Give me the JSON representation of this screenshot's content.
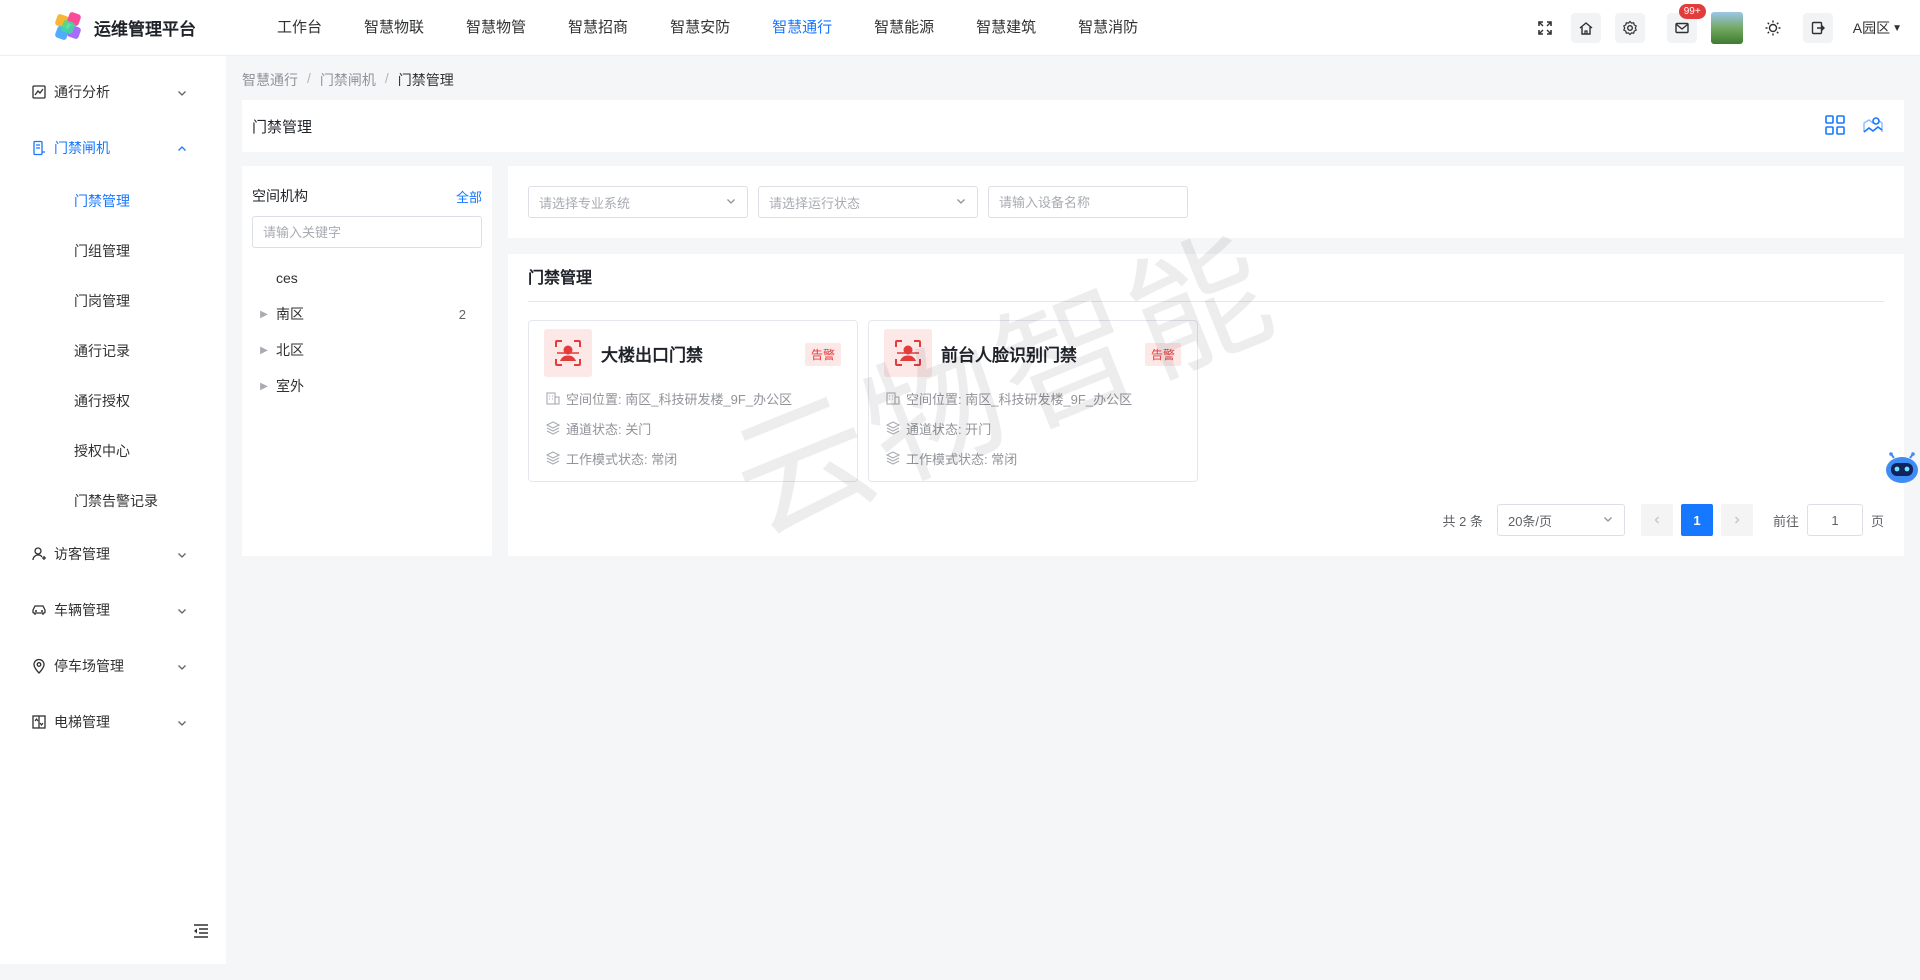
{
  "app": {
    "title": "运维管理平台"
  },
  "nav": {
    "items": [
      "工作台",
      "智慧物联",
      "智慧物管",
      "智慧招商",
      "智慧安防",
      "智慧通行",
      "智慧能源",
      "智慧建筑",
      "智慧消防"
    ],
    "active_index": 5
  },
  "header": {
    "mail_badge": "99+",
    "region": "A园区"
  },
  "sidebar": {
    "items": [
      {
        "label": "通行分析",
        "icon": "chart-icon"
      },
      {
        "label": "门禁闸机",
        "icon": "gate-icon",
        "open": true,
        "children": [
          "门禁管理",
          "门组管理",
          "门岗管理",
          "通行记录",
          "通行授权",
          "授权中心",
          "门禁告警记录"
        ]
      },
      {
        "label": "访客管理",
        "icon": "visitor-icon"
      },
      {
        "label": "车辆管理",
        "icon": "car-icon"
      },
      {
        "label": "停车场管理",
        "icon": "location-icon"
      },
      {
        "label": "电梯管理",
        "icon": "elevator-icon"
      }
    ],
    "active_child": "门禁管理"
  },
  "breadcrumb": [
    "智慧通行",
    "门禁闸机",
    "门禁管理"
  ],
  "page": {
    "title": "门禁管理"
  },
  "tree": {
    "title": "空间机构",
    "all_label": "全部",
    "search_placeholder": "请输入关键字",
    "nodes": [
      {
        "label": "ces",
        "expandable": false,
        "count": ""
      },
      {
        "label": "南区",
        "expandable": true,
        "count": "2"
      },
      {
        "label": "北区",
        "expandable": true,
        "count": ""
      },
      {
        "label": "室外",
        "expandable": true,
        "count": ""
      }
    ]
  },
  "filters": {
    "system_placeholder": "请选择专业系统",
    "status_placeholder": "请选择运行状态",
    "name_placeholder": "请输入设备名称"
  },
  "list": {
    "title": "门禁管理",
    "cards": [
      {
        "name": "大楼出口门禁",
        "badge": "告警",
        "location": "空间位置: 南区_科技研发楼_9F_办公区",
        "channel": "通道状态: 关门",
        "mode": "工作模式状态: 常闭"
      },
      {
        "name": "前台人脸识别门禁",
        "badge": "告警",
        "location": "空间位置: 南区_科技研发楼_9F_办公区",
        "channel": "通道状态: 开门",
        "mode": "工作模式状态: 常闭"
      }
    ]
  },
  "pager": {
    "total": "共 2 条",
    "page_size": "20条/页",
    "current_page": "1",
    "goto_label": "前往",
    "goto_value": "1",
    "page_suffix": "页"
  },
  "watermark": "云物智能",
  "colors": {
    "accent": "#1677ff",
    "alarm": "#e23c3c",
    "alarm_bg": "#fde8e8"
  }
}
